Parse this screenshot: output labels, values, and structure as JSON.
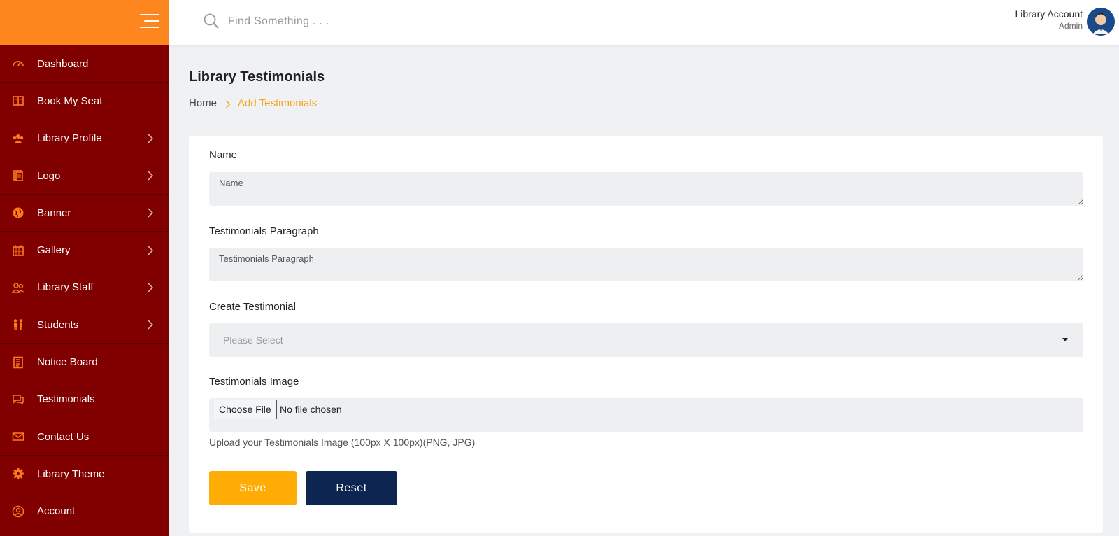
{
  "colors": {
    "sidebar_bg": "#800000",
    "sidebar_header": "#fe861e",
    "icon_accent": "#ff7a1a",
    "breadcrumb_active": "#f5a31a",
    "save_button": "#ffad05",
    "reset_button": "#0c2551"
  },
  "sidebar": {
    "items": [
      {
        "label": "Dashboard",
        "icon": "speedometer-icon",
        "has_children": false
      },
      {
        "label": "Book My Seat",
        "icon": "book-icon",
        "has_children": false
      },
      {
        "label": "Library Profile",
        "icon": "users-icon",
        "has_children": true
      },
      {
        "label": "Logo",
        "icon": "documents-icon",
        "has_children": true
      },
      {
        "label": "Banner",
        "icon": "globe-icon",
        "has_children": true
      },
      {
        "label": "Gallery",
        "icon": "gallery-icon",
        "has_children": true
      },
      {
        "label": "Library Staff",
        "icon": "staff-icon",
        "has_children": true
      },
      {
        "label": "Students",
        "icon": "students-icon",
        "has_children": true
      },
      {
        "label": "Notice Board",
        "icon": "notice-icon",
        "has_children": false
      },
      {
        "label": "Testimonials",
        "icon": "chat-icon",
        "has_children": false
      },
      {
        "label": "Contact Us",
        "icon": "envelope-icon",
        "has_children": false
      },
      {
        "label": "Library Theme",
        "icon": "gear-icon",
        "has_children": false
      },
      {
        "label": "Account",
        "icon": "account-icon",
        "has_children": false
      }
    ]
  },
  "topbar": {
    "search_placeholder": "Find Something . . .",
    "account_name": "Library Account",
    "account_role": "Admin"
  },
  "page": {
    "title": "Library Testimonials",
    "breadcrumb": {
      "home": "Home",
      "current": "Add Testimonials"
    }
  },
  "form": {
    "name_label": "Name",
    "name_placeholder": "Name",
    "paragraph_label": "Testimonials Paragraph",
    "paragraph_placeholder": "Testimonials Paragraph",
    "create_label": "Create Testimonial",
    "create_selected": "Please Select",
    "image_label": "Testimonials Image",
    "file_button": "Choose File",
    "file_status": "No file chosen",
    "image_help": "Upload your Testimonials Image (100px X 100px)(PNG, JPG)",
    "save_label": "Save",
    "reset_label": "Reset"
  }
}
